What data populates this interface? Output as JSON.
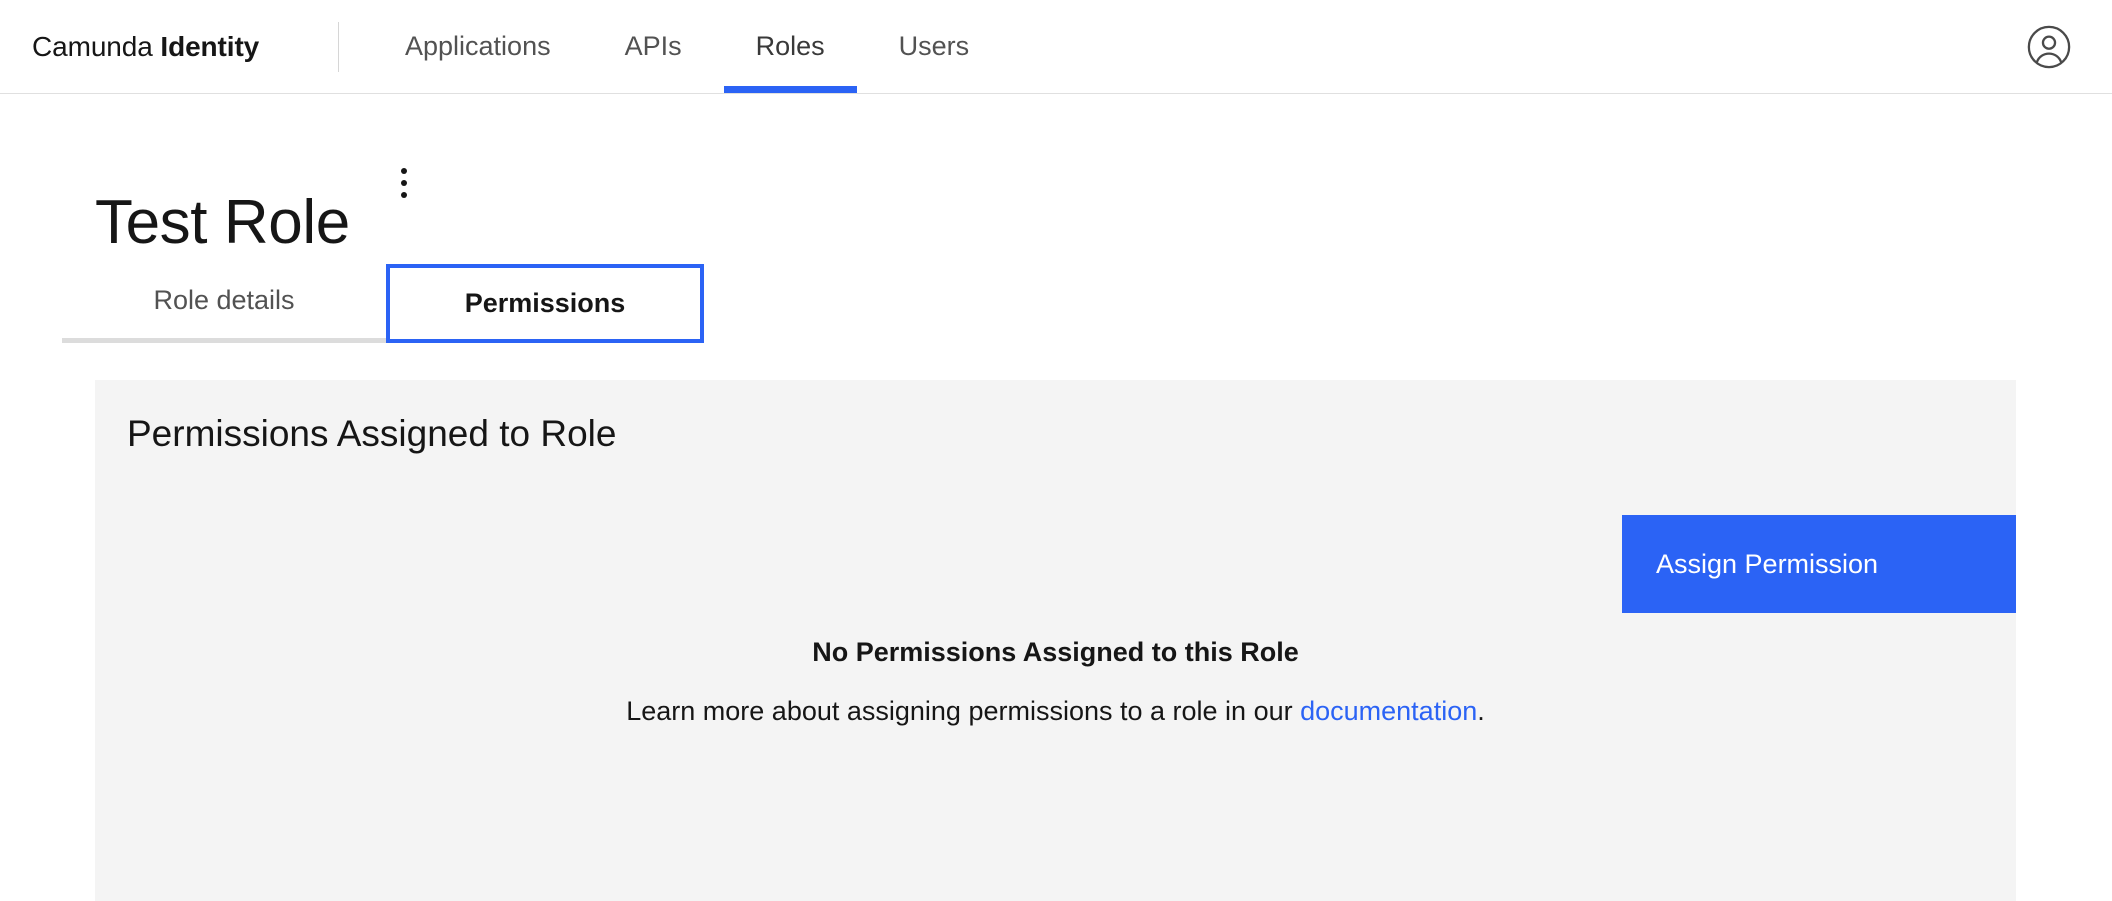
{
  "header": {
    "brand_prefix": "Camunda ",
    "brand_suffix": "Identity",
    "nav": [
      {
        "label": "Applications",
        "active": false
      },
      {
        "label": "APIs",
        "active": false
      },
      {
        "label": "Roles",
        "active": true
      },
      {
        "label": "Users",
        "active": false
      }
    ],
    "avatar_icon": "user-avatar-icon"
  },
  "page": {
    "title": "Test Role",
    "overflow_menu_icon": "overflow-menu-vertical-icon",
    "tabs": [
      {
        "label": "Role details",
        "active": false
      },
      {
        "label": "Permissions",
        "active": true
      }
    ]
  },
  "card": {
    "title": "Permissions Assigned to Role",
    "assign_button_label": "Assign Permission",
    "empty_state": {
      "title": "No Permissions Assigned to this Role",
      "text_before_link": "Learn more about assigning permissions to a role in our ",
      "link_label": "documentation",
      "text_after_link": "."
    }
  },
  "colors": {
    "accent_blue": "#2b63f5",
    "card_background": "#f4f4f4",
    "text_primary": "#161616",
    "text_secondary": "#525252",
    "border_gray": "#e0e0e0"
  }
}
